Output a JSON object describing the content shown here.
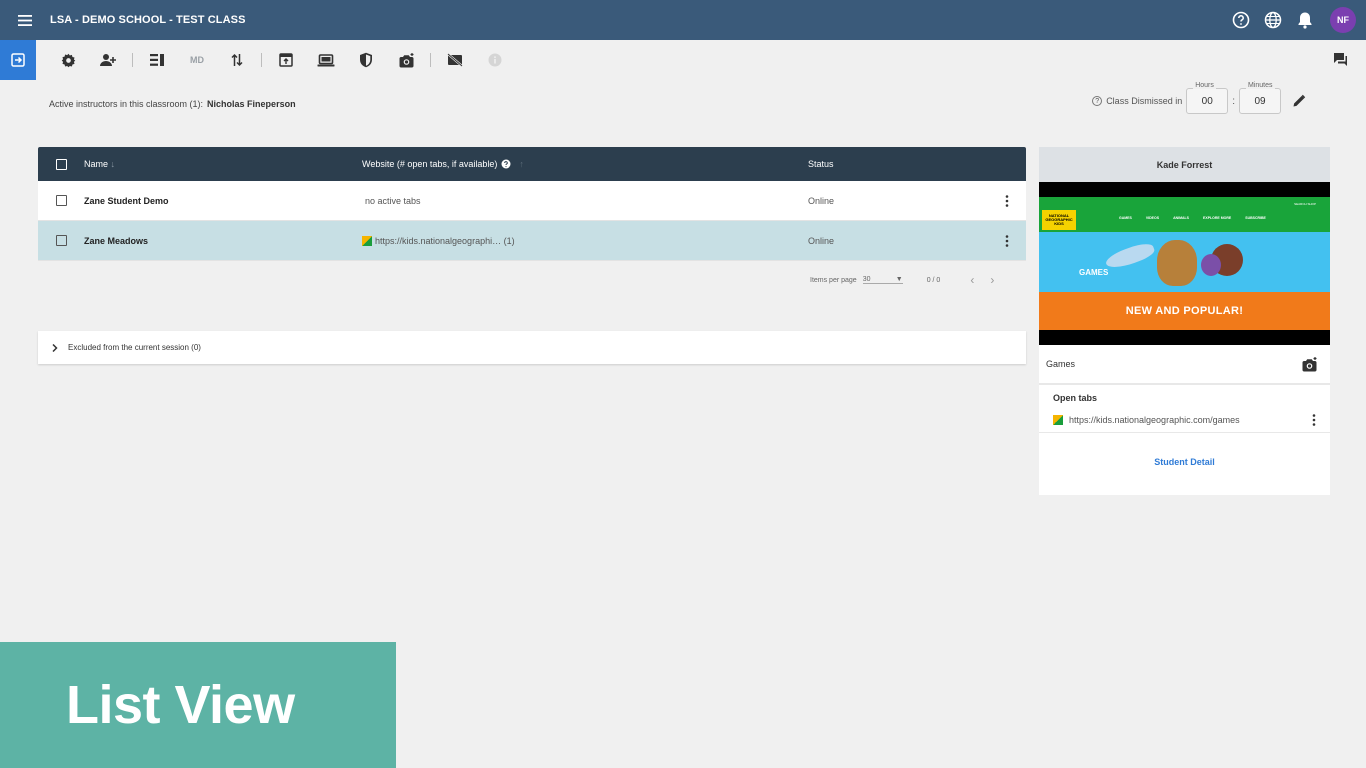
{
  "appbar": {
    "title": "LSA - DEMO SCHOOL - TEST CLASS",
    "avatar_initials": "NF",
    "color": "#3a5a7a"
  },
  "toolbar": {
    "md_label": "MD",
    "accent": "#2f7bd6",
    "icons": [
      "exit-icon",
      "settings-icon",
      "add-person-icon",
      "view-columns-icon",
      "sort-icon",
      "open-tab-icon",
      "laptop-icon",
      "shield-icon",
      "camera-icon",
      "screen-off-icon",
      "info-icon",
      "chat-icon"
    ]
  },
  "info": {
    "instructors_label": "Active instructors in this classroom (1):",
    "instructor_name": "Nicholas Fineperson",
    "dismiss_label": "Class Dismissed in",
    "hours_label": "Hours",
    "hours_value": "00",
    "minutes_label": "Minutes",
    "minutes_value": "09",
    "colon": ":"
  },
  "table": {
    "headers": {
      "name": "Name",
      "website": "Website (# open tabs, if available)",
      "status": "Status"
    },
    "rows": [
      {
        "name": "Zane Student Demo",
        "website": "no active tabs",
        "status": "Online"
      },
      {
        "name": "Zane Meadows",
        "website": "https://kids.nationalgeographi… (1)",
        "status": "Online"
      }
    ]
  },
  "pager": {
    "items_label": "Items per page",
    "items_value": "30",
    "range": "0 / 0"
  },
  "excluded": {
    "label": "Excluded from the current session (0)"
  },
  "panel": {
    "student_name": "Kade Forrest",
    "page_title": "Games",
    "open_tabs_label": "Open tabs",
    "tab_url": "https://kids.nationalgeographic.com/games",
    "detail_link": "Student Detail",
    "thumb": {
      "logo": "NATIONAL GEOGRAPHIC KIDS",
      "nav": [
        "GAMES",
        "VIDEOS",
        "ANIMALS",
        "EXPLORE MORE",
        "SUBSCRIBE"
      ],
      "top_links": "SEARCH    SHOP",
      "games_label": "GAMES",
      "banner": "NEW AND POPULAR!"
    }
  },
  "overlay": {
    "label": "List View"
  }
}
